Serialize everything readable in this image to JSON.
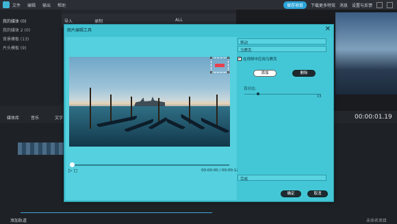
{
  "menubar": {
    "items": [
      "文件",
      "编辑",
      "输出",
      "帮助"
    ],
    "save_label": "保存项目",
    "download_label": "下载更多特效",
    "news_label": "消息",
    "prefs_label": "设置与反馈"
  },
  "library": {
    "items": [
      "我的媒体 (0)",
      "我的媒体 2 (0)",
      "背景模板 (13)",
      "片头模板 (9)"
    ]
  },
  "mediatool": {
    "import_label": "导入",
    "record_label": "录制",
    "filter_label": "ALL"
  },
  "toolrow": {
    "media_label": "媒体库",
    "audio_label": "音乐",
    "text_label": "文字"
  },
  "preview": {
    "timecode": "00:00:01.19"
  },
  "bottom": {
    "add_track": "添加轨道",
    "unnamed": "未命名项目"
  },
  "dialog": {
    "title": "图片编辑工具",
    "close": "✕",
    "time": "00:00:00 / 00:00:12",
    "effect_select": "移动",
    "type_select": "马赛克",
    "checkbox_label": "在视频中应用马赛克",
    "checkbox_state": "✓",
    "add_button": "添加",
    "delete_button": "删除",
    "percent_label": "百分比:",
    "percent_value": "13",
    "bottom_select": "完成",
    "ok_button": "确定",
    "cancel_button": "取消"
  },
  "colors": {
    "dialog_bg": "#41c3d3",
    "accent": "#2aa3d8",
    "mark": "#e8404f"
  }
}
